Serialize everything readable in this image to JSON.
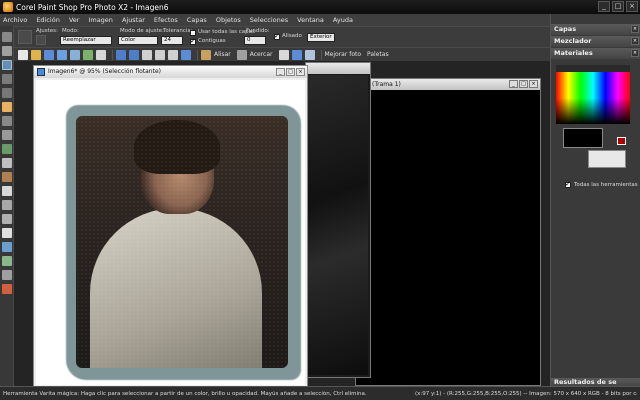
{
  "window": {
    "title": "Corel Paint Shop Pro Photo X2 - Imagen6",
    "minimize": "_",
    "maximize": "□",
    "close": "×"
  },
  "menu": [
    "Archivo",
    "Edición",
    "Ver",
    "Imagen",
    "Ajustar",
    "Efectos",
    "Capas",
    "Objetos",
    "Selecciones",
    "Ventana",
    "Ayuda"
  ],
  "options": {
    "ajustes_label": "Ajustes:",
    "modo_label": "Modo:",
    "modo_value": "Reemplazar",
    "modo_ajuste_label": "Modo de ajuste:",
    "modo_ajuste_value": "Color",
    "tolerancia_label": "Tolerancia:",
    "tolerancia_value": "24",
    "usar_todas_capas": "Usar todas las capas",
    "contiguas": "Contiguas",
    "fundido_label": "Fundido:",
    "fundido_value": "0",
    "alisado": "Alisado",
    "exterior_value": "Exterior"
  },
  "toolbar": {
    "alinear": "Alisar",
    "acercar": "Acercar",
    "mejorar_foto": "Mejorar foto",
    "paletas": "Paletas"
  },
  "windows": {
    "front_title": "Imagen6* @  95% (Selección flotante)",
    "back_title": "(Trama 1)"
  },
  "panels": {
    "capas": "Capas",
    "mezclador": "Mezclador",
    "materiales": "Materiales",
    "todas_herramientas": "Todas las herramientas",
    "resultados": "Resultados de se"
  },
  "status": {
    "left": "Herramienta Varita mágica: Haga clic para seleccionar a partir de un color, brillo u opacidad. Mayús añade a selección, Ctrl elimina.",
    "right": "(x:97 y:1) - (R:255,G:255,B:255,O:255) -- Imagen: 570 x 640 x RGB - 8 bits por canal"
  }
}
